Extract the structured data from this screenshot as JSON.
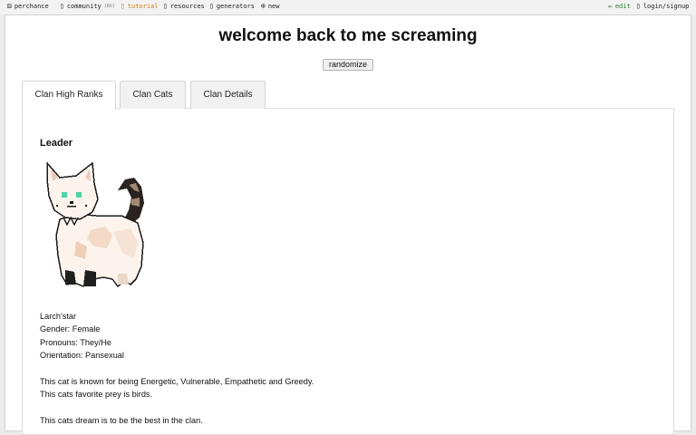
{
  "nav": {
    "left": [
      {
        "icon": "dice-icon",
        "glyph": "⚄",
        "label": "perchance"
      },
      {
        "icon": "community-icon",
        "glyph": "▯",
        "label": "community",
        "badge": "(6h)"
      },
      {
        "icon": "tutorial-icon",
        "glyph": "▯",
        "label": "tutorial"
      },
      {
        "icon": "resources-icon",
        "glyph": "▯",
        "label": "resources"
      },
      {
        "icon": "generators-icon",
        "glyph": "▯",
        "label": "generators"
      },
      {
        "icon": "new-icon",
        "glyph": "⊕",
        "label": "new"
      }
    ],
    "right": [
      {
        "icon": "edit-icon",
        "glyph": "✏",
        "label": "edit"
      },
      {
        "icon": "login-icon",
        "glyph": "▯",
        "label": "login/signup"
      }
    ]
  },
  "page": {
    "title": "welcome back to me screaming",
    "randomize_label": "randomize"
  },
  "tabs": [
    {
      "label": "Clan High Ranks",
      "active": true
    },
    {
      "label": "Clan Cats",
      "active": false
    },
    {
      "label": "Clan Details",
      "active": false
    }
  ],
  "leader": {
    "heading": "Leader",
    "name": "Larch'star",
    "gender": "Gender: Female",
    "pronouns": "Pronouns: They/He",
    "orientation": "Orientation: Pansexual",
    "traits": "This cat is known for being Energetic, Vulnerable, Empathetic and Greedy.",
    "prey": "This cats favorite prey is birds.",
    "dream": "This cats dream is to be the best in the clan."
  }
}
